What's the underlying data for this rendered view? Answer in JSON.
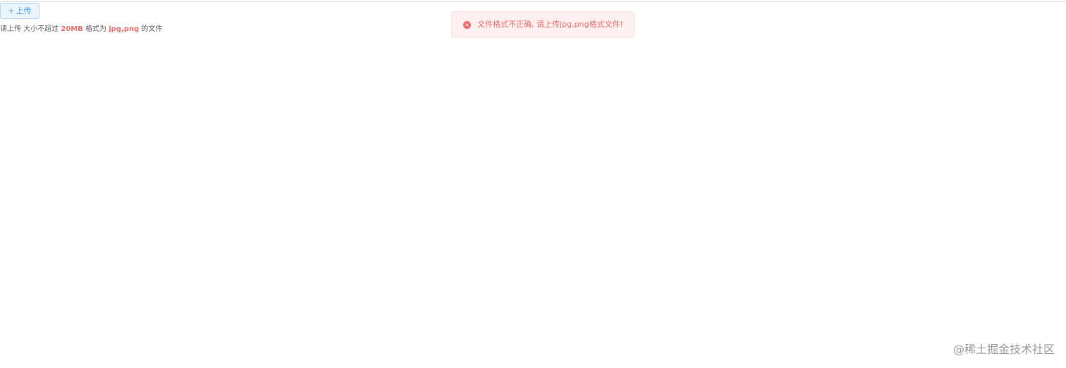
{
  "upload": {
    "button_plus": "+",
    "button_label": "上传"
  },
  "tip": {
    "prefix": "请上传 大小不超过 ",
    "size": "20MB",
    "middle": " 格式为 ",
    "formats": "jpg,png",
    "suffix": " 的文件"
  },
  "message": {
    "icon": "close-circle-icon",
    "text": "文件格式不正确, 请上传jpg,png格式文件!",
    "color": "#f56c6c",
    "background": "#fef0f0"
  },
  "watermark": {
    "text": "@稀土掘金技术社区"
  },
  "colors": {
    "primary": "#409eff",
    "danger": "#f56c6c"
  }
}
